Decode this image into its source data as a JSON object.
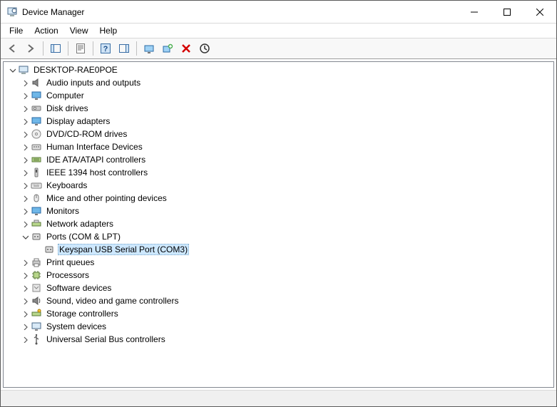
{
  "window": {
    "title": "Device Manager"
  },
  "menu": {
    "file": "File",
    "action": "Action",
    "view": "View",
    "help": "Help"
  },
  "toolbar": {
    "back": "Back",
    "forward": "Forward",
    "show_hide": "Show/Hide Console Tree",
    "properties": "Properties",
    "help": "Help",
    "show_hide_action": "Show/Hide Action Pane",
    "update": "Scan for hardware changes",
    "add_legacy": "Add legacy hardware",
    "uninstall": "Uninstall device",
    "scan": "Update device driver"
  },
  "tree": {
    "root": {
      "label": "DESKTOP-RAE0POE",
      "expanded": true,
      "icon": "computer"
    },
    "nodes": [
      {
        "label": "Audio inputs and outputs",
        "icon": "audio"
      },
      {
        "label": "Computer",
        "icon": "monitor"
      },
      {
        "label": "Disk drives",
        "icon": "disk"
      },
      {
        "label": "Display adapters",
        "icon": "monitor"
      },
      {
        "label": "DVD/CD-ROM drives",
        "icon": "disc"
      },
      {
        "label": "Human Interface Devices",
        "icon": "hid"
      },
      {
        "label": "IDE ATA/ATAPI controllers",
        "icon": "ide"
      },
      {
        "label": "IEEE 1394 host controllers",
        "icon": "ieee"
      },
      {
        "label": "Keyboards",
        "icon": "keyboard"
      },
      {
        "label": "Mice and other pointing devices",
        "icon": "mouse"
      },
      {
        "label": "Monitors",
        "icon": "monitor"
      },
      {
        "label": "Network adapters",
        "icon": "network"
      },
      {
        "label": "Ports (COM & LPT)",
        "icon": "port",
        "expanded": true,
        "children": [
          {
            "label": "Keyspan USB Serial Port (COM3)",
            "icon": "port",
            "selected": true
          }
        ]
      },
      {
        "label": "Print queues",
        "icon": "printer"
      },
      {
        "label": "Processors",
        "icon": "cpu"
      },
      {
        "label": "Software devices",
        "icon": "software"
      },
      {
        "label": "Sound, video and game controllers",
        "icon": "sound"
      },
      {
        "label": "Storage controllers",
        "icon": "storage"
      },
      {
        "label": "System devices",
        "icon": "system"
      },
      {
        "label": "Universal Serial Bus controllers",
        "icon": "usb"
      }
    ]
  }
}
